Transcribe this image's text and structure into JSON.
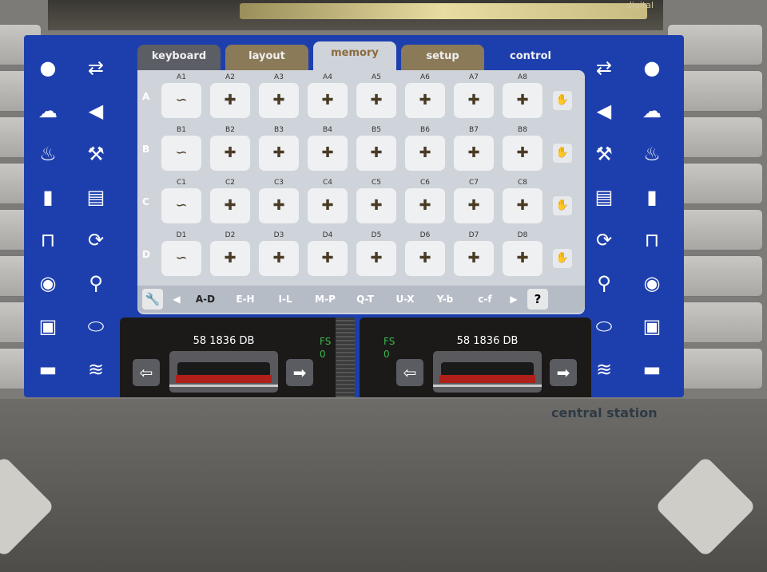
{
  "device": {
    "brand_top": "digital",
    "brand_label": "central station"
  },
  "tabs": [
    {
      "label": "keyboard"
    },
    {
      "label": "layout"
    },
    {
      "label": "memory",
      "active": true
    },
    {
      "label": "setup"
    },
    {
      "label": "control"
    }
  ],
  "rows": [
    {
      "label": "A",
      "cells": [
        "A1",
        "A2",
        "A3",
        "A4",
        "A5",
        "A6",
        "A7",
        "A8"
      ]
    },
    {
      "label": "B",
      "cells": [
        "B1",
        "B2",
        "B3",
        "B4",
        "B5",
        "B6",
        "B7",
        "B8"
      ]
    },
    {
      "label": "C",
      "cells": [
        "C1",
        "C2",
        "C3",
        "C4",
        "C5",
        "C6",
        "C7",
        "C8"
      ]
    },
    {
      "label": "D",
      "cells": [
        "D1",
        "D2",
        "D3",
        "D4",
        "D5",
        "D6",
        "D7",
        "D8"
      ]
    }
  ],
  "pages": [
    "A-D",
    "E-H",
    "I-L",
    "M-P",
    "Q-T",
    "U-X",
    "Y-b",
    "c-f"
  ],
  "active_page": "A-D",
  "help_label": "?",
  "locos": [
    {
      "name": "58 1836 DB",
      "fs_label": "FS",
      "speed": "0"
    },
    {
      "name": "58 1836 DB",
      "fs_label": "FS",
      "speed": "0"
    }
  ],
  "side_icons_left": [
    "light-icon",
    "shunting-icon",
    "smoke-icon",
    "horn-icon",
    "sound-icon",
    "crane-icon",
    "pantograph-icon",
    "cab-light-icon",
    "coupler-icon",
    "telex-icon",
    "whistle-icon",
    "fan-icon",
    "bell-icon",
    "compressor-icon",
    "train-front-icon",
    "brake-icon"
  ],
  "colors": {
    "screen": "#1d3fae",
    "active_tab_text": "#8a6b3c",
    "speed_text": "#3bb84a"
  }
}
